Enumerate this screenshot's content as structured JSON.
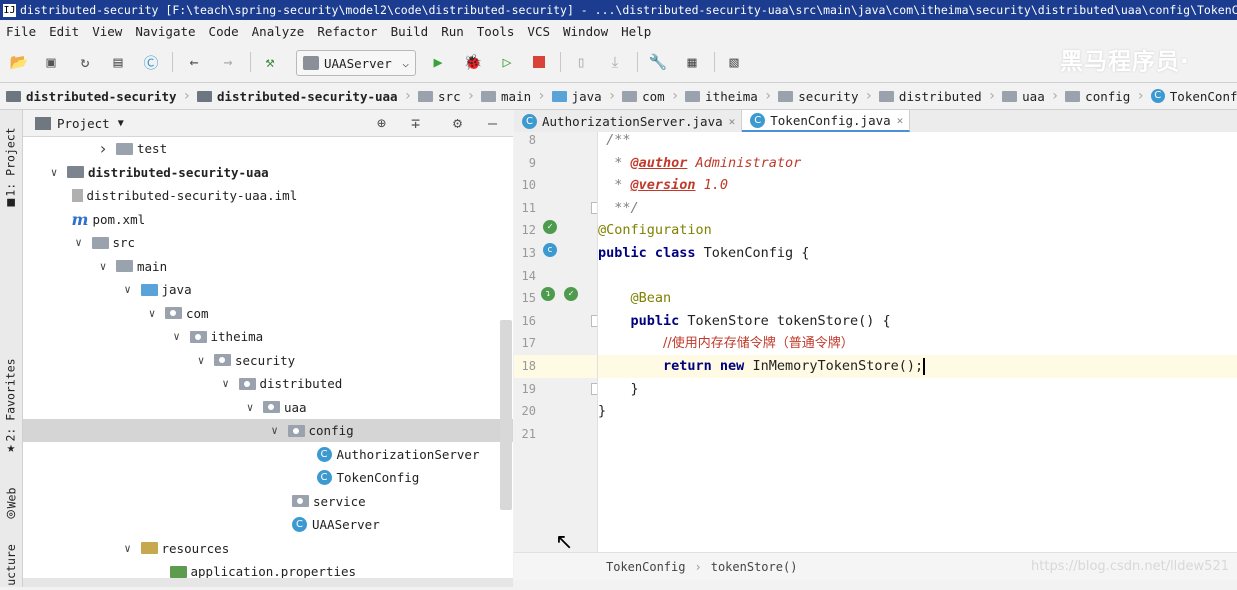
{
  "window": {
    "title": "distributed-security [F:\\teach\\spring-security\\model2\\code\\distributed-security] - ...\\distributed-security-uaa\\src\\main\\java\\com\\itheima\\security\\distributed\\uaa\\config\\TokenConfig.java",
    "logo_glyph": "IJ"
  },
  "menu": [
    "File",
    "Edit",
    "View",
    "Navigate",
    "Code",
    "Analyze",
    "Refactor",
    "Build",
    "Run",
    "Tools",
    "VCS",
    "Window",
    "Help"
  ],
  "toolbar": {
    "run_config": "UAAServer",
    "watermark": "黑马程序员·"
  },
  "breadcrumbs": [
    {
      "label": "distributed-security",
      "bold": true,
      "icon": "module-folder-icon"
    },
    {
      "label": "distributed-security-uaa",
      "bold": true,
      "icon": "module-folder-icon"
    },
    {
      "label": "src",
      "icon": "folder-icon"
    },
    {
      "label": "main",
      "icon": "folder-icon"
    },
    {
      "label": "java",
      "icon": "source-folder-icon"
    },
    {
      "label": "com",
      "icon": "package-icon"
    },
    {
      "label": "itheima",
      "icon": "package-icon"
    },
    {
      "label": "security",
      "icon": "package-icon"
    },
    {
      "label": "distributed",
      "icon": "package-icon"
    },
    {
      "label": "uaa",
      "icon": "package-icon"
    },
    {
      "label": "config",
      "icon": "package-icon"
    },
    {
      "label": "TokenConfig",
      "icon": "class-icon"
    }
  ],
  "side_tabs": {
    "project": "1: Project",
    "favorites": "2: Favorites",
    "web": "Web",
    "structure": "ucture"
  },
  "project_panel": {
    "title": "Project",
    "tree": [
      {
        "label": "test",
        "indent": 3,
        "arrow": "right",
        "icon": "folder"
      },
      {
        "label": "distributed-security-uaa",
        "indent": 1,
        "arrow": "down",
        "icon": "module",
        "bold": true
      },
      {
        "label": "distributed-security-uaa.iml",
        "indent": 2,
        "arrow": "",
        "icon": "iml"
      },
      {
        "label": "pom.xml",
        "indent": 2,
        "arrow": "",
        "icon": "maven"
      },
      {
        "label": "src",
        "indent": 2,
        "arrow": "down",
        "icon": "folder"
      },
      {
        "label": "main",
        "indent": 3,
        "arrow": "down",
        "icon": "folder"
      },
      {
        "label": "java",
        "indent": 4,
        "arrow": "down",
        "icon": "source"
      },
      {
        "label": "com",
        "indent": 5,
        "arrow": "down",
        "icon": "package"
      },
      {
        "label": "itheima",
        "indent": 6,
        "arrow": "down",
        "icon": "package"
      },
      {
        "label": "security",
        "indent": 7,
        "arrow": "down",
        "icon": "package"
      },
      {
        "label": "distributed",
        "indent": 8,
        "arrow": "down",
        "icon": "package"
      },
      {
        "label": "uaa",
        "indent": 9,
        "arrow": "down",
        "icon": "package"
      },
      {
        "label": "config",
        "indent": 10,
        "arrow": "down",
        "icon": "package",
        "selected": true
      },
      {
        "label": "AuthorizationServer",
        "indent": 12,
        "arrow": "",
        "icon": "class"
      },
      {
        "label": "TokenConfig",
        "indent": 12,
        "arrow": "",
        "icon": "class"
      },
      {
        "label": "service",
        "indent": 11,
        "arrow": "",
        "icon": "package"
      },
      {
        "label": "UAAServer",
        "indent": 11,
        "arrow": "",
        "icon": "class"
      },
      {
        "label": "resources",
        "indent": 4,
        "arrow": "down",
        "icon": "resources"
      },
      {
        "label": "application.properties",
        "indent": 6,
        "arrow": "",
        "icon": "properties"
      }
    ]
  },
  "editor": {
    "tabs": [
      {
        "label": "AuthorizationServer.java",
        "active": false
      },
      {
        "label": "TokenConfig.java",
        "active": true
      }
    ],
    "lines": [
      {
        "n": "8",
        "html": "<span class='c-com'> /**</span>"
      },
      {
        "n": "9",
        "html": "<span class='c-com'>  * </span><span class='c-tag'>@author</span><span class='c-tagv'> Administrator</span>"
      },
      {
        "n": "10",
        "html": "<span class='c-com'>  * </span><span class='c-tag'>@version</span><span class='c-tagv'> 1.0</span>"
      },
      {
        "n": "11",
        "html": "<span class='c-com'>  **/</span>"
      },
      {
        "n": "12",
        "html": "<span class='c-ann'>@Configuration</span>"
      },
      {
        "n": "13",
        "html": "<span class='c-kw'>public class</span> TokenConfig {"
      },
      {
        "n": "14",
        "html": ""
      },
      {
        "n": "15",
        "html": "    <span class='c-ann'>@Bean</span>"
      },
      {
        "n": "16",
        "html": "    <span class='c-kw'>public</span> TokenStore tokenStore() {"
      },
      {
        "n": "17",
        "html": "        <span class='c-zh'>//使用内存存储令牌（普通令牌）</span>"
      },
      {
        "n": "18",
        "html": "        <span class='c-kw'>return new</span> InMemoryTokenStore();<span class='caret'></span>",
        "current": true
      },
      {
        "n": "19",
        "html": "    }"
      },
      {
        "n": "20",
        "html": "}"
      },
      {
        "n": "21",
        "html": ""
      }
    ],
    "footer_breadcrumb": [
      "TokenConfig",
      "tokenStore()"
    ],
    "footer_watermark": "https://blog.csdn.net/lldew521"
  }
}
